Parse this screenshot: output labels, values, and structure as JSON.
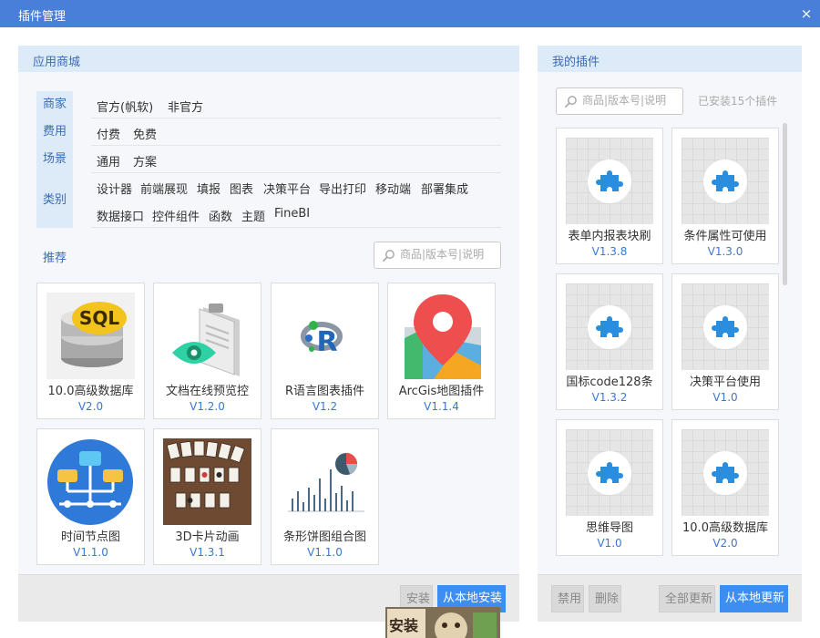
{
  "window": {
    "title": "插件管理",
    "close_icon": "×"
  },
  "store": {
    "header": "应用商城",
    "filters": [
      {
        "tab": "商家",
        "options": [
          "官方(帆软)",
          "非官方"
        ]
      },
      {
        "tab": "费用",
        "options": [
          "付费",
          "免费"
        ]
      },
      {
        "tab": "场景",
        "options": [
          "通用",
          "方案"
        ]
      },
      {
        "tab": "类别",
        "options": [
          "设计器",
          "前端展现",
          "填报",
          "图表",
          "决策平台",
          "导出打印",
          "移动端",
          "部署集成",
          "数据接口",
          "控件组件",
          "函数",
          "主题",
          "FineBI"
        ]
      }
    ],
    "recommend_label": "推荐",
    "search_placeholder": "商品|版本号|说明",
    "cards": [
      {
        "name": "10.0高级数据库",
        "version": "V2.0",
        "icon": "sql-database-icon"
      },
      {
        "name": "文档在线预览控",
        "version": "V1.2.0",
        "icon": "document-preview-icon"
      },
      {
        "name": "R语言图表插件",
        "version": "V1.2",
        "icon": "r-language-icon"
      },
      {
        "name": "ArcGis地图插件",
        "version": "V1.1.4",
        "icon": "map-pin-icon"
      },
      {
        "name": "时间节点图",
        "version": "V1.1.0",
        "icon": "timeline-node-icon"
      },
      {
        "name": "3D卡片动画",
        "version": "V1.3.1",
        "icon": "card-animation-icon"
      },
      {
        "name": "条形饼图组合图",
        "version": "V1.1.0",
        "icon": "bar-pie-chart-icon"
      }
    ],
    "footer": {
      "install": "安装",
      "local_install": "从本地安装"
    }
  },
  "mine": {
    "header": "我的插件",
    "search_placeholder": "商品|版本号|说明",
    "installed_count": "已安装15个插件",
    "plugins": [
      {
        "name": "表单内报表块刷",
        "version": "V1.3.8"
      },
      {
        "name": "条件属性可使用",
        "version": "V1.3.0"
      },
      {
        "name": "国标code128条",
        "version": "V1.3.2"
      },
      {
        "name": "决策平台使用",
        "version": "V1.0"
      },
      {
        "name": "思维导图",
        "version": "V1.0"
      },
      {
        "name": "10.0高级数据库",
        "version": "V2.0"
      }
    ],
    "footer": {
      "disable": "禁用",
      "delete": "删除",
      "update_all": "全部更新",
      "local_update": "从本地更新"
    }
  },
  "mascot": {
    "text": "安装"
  },
  "colors": {
    "titlebar": "#4a7fd9",
    "accent": "#3a78d4",
    "header_bg": "#ddebf9",
    "primary_button": "#3d8ef0"
  }
}
